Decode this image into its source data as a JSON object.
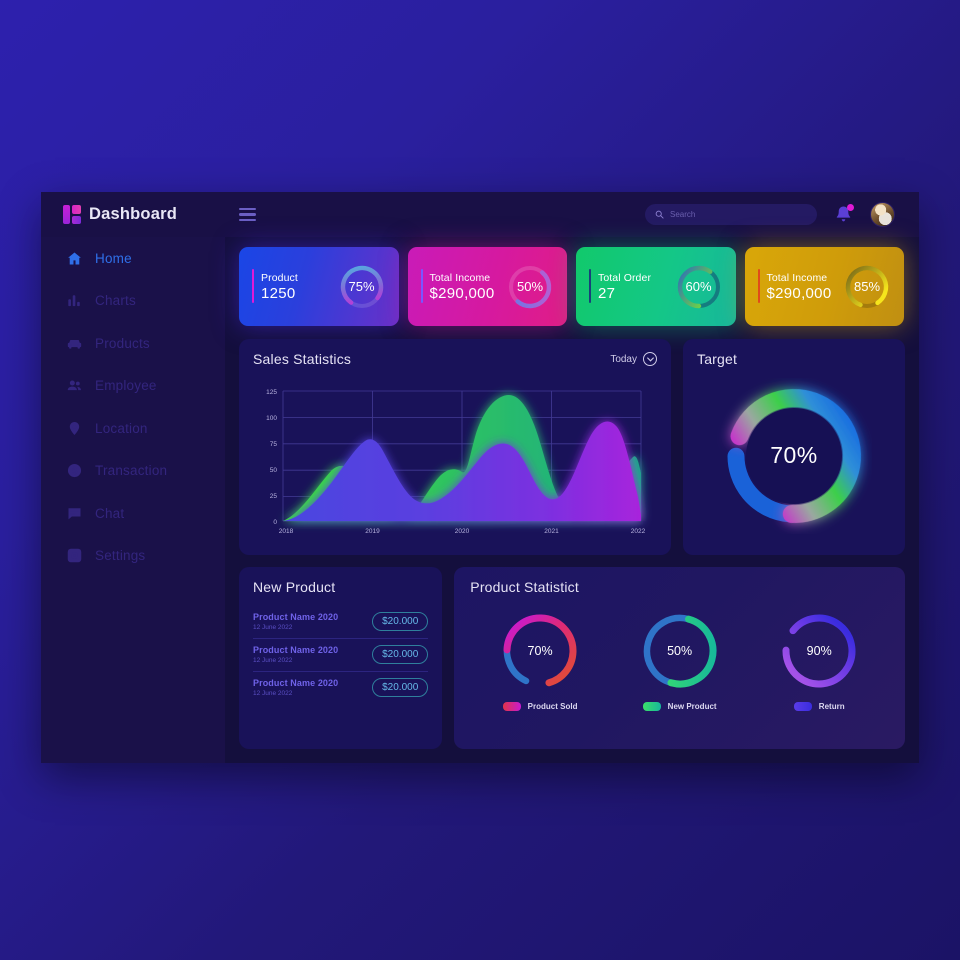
{
  "brand": {
    "title": "Dashboard",
    "logo_icon": "logo-blocks-icon"
  },
  "topbar": {
    "menu_icon": "hamburger-icon",
    "search": {
      "placeholder": "Search",
      "value": "",
      "icon": "search-icon"
    },
    "bell_icon": "bell-icon",
    "avatar": "user-avatar"
  },
  "sidebar": {
    "items": [
      {
        "label": "Home",
        "icon": "home-icon",
        "active": true
      },
      {
        "label": "Charts",
        "icon": "bar-chart-icon",
        "active": false
      },
      {
        "label": "Products",
        "icon": "car-icon",
        "active": false
      },
      {
        "label": "Employee",
        "icon": "people-icon",
        "active": false
      },
      {
        "label": "Location",
        "icon": "map-pin-icon",
        "active": false
      },
      {
        "label": "Transaction",
        "icon": "dollar-coin-icon",
        "active": false
      },
      {
        "label": "Chat",
        "icon": "chat-icon",
        "active": false
      },
      {
        "label": "Settings",
        "icon": "gear-icon",
        "active": false
      }
    ]
  },
  "stat_cards": [
    {
      "title": "Product",
      "value": "1250",
      "percent": "75%",
      "percent_num": 75,
      "accent": "#e01ad6",
      "ring_from": "#7b5fe8",
      "ring_to": "#e01ad6"
    },
    {
      "title": "Total Income",
      "value": "$290,000",
      "percent": "50%",
      "percent_num": 50,
      "accent": "#7a56ff",
      "ring_from": "#6f7ae8",
      "ring_to": "#b05bd8"
    },
    {
      "title": "Total Order",
      "value": "27",
      "percent": "60%",
      "percent_num": 60,
      "accent": "#18407a",
      "ring_from": "#2f6fb8",
      "ring_to": "#6ee038"
    },
    {
      "title": "Total Income",
      "value": "$290,000",
      "percent": "85%",
      "percent_num": 85,
      "accent": "#e04b1a",
      "ring_from": "#8a7a20",
      "ring_to": "#f2e31a"
    }
  ],
  "sales_panel": {
    "title": "Sales Statistics",
    "filter_label": "Today",
    "filter_icon": "chevron-down-circle-icon"
  },
  "target_panel": {
    "title": "Target",
    "percent": "70%",
    "percent_num": 70
  },
  "new_product_panel": {
    "title": "New Product",
    "rows": [
      {
        "name": "Product Name 2020",
        "date": "12 June 2022",
        "price": "$20.000"
      },
      {
        "name": "Product Name 2020",
        "date": "12 June 2022",
        "price": "$20.000"
      },
      {
        "name": "Product Name 2020",
        "date": "12 June 2022",
        "price": "$20.000"
      }
    ]
  },
  "product_statistic_panel": {
    "title": "Product Statistict",
    "donuts": [
      {
        "percent": "70%",
        "percent_num": 70,
        "label": "Product Sold",
        "from": "#e03a3a",
        "to": "#d61a9c"
      },
      {
        "percent": "50%",
        "percent_num": 50,
        "label": "New Product",
        "from": "#2fd07a",
        "to": "#18b79c"
      },
      {
        "percent": "90%",
        "percent_num": 90,
        "label": "Return",
        "from": "#9a4de8",
        "to": "#3a2ce0"
      }
    ]
  },
  "chart_data": [
    {
      "type": "area",
      "title": "Sales Statistics",
      "xlabel": "",
      "ylabel": "",
      "x": [
        "2018",
        "2019",
        "2020",
        "2021",
        "2022"
      ],
      "yticks": [
        0,
        25,
        50,
        75,
        100,
        125
      ],
      "ylim": [
        0,
        125
      ],
      "grid": true,
      "legend": "none",
      "series": [
        {
          "name": "Green series",
          "color": "#2fc45f",
          "values": [
            3,
            30,
            40,
            115,
            30,
            50
          ]
        },
        {
          "name": "Purple series",
          "color": "#6a3fe0",
          "values": [
            3,
            65,
            27,
            70,
            100,
            30
          ]
        }
      ],
      "note": "Two smooth stacked area curves; green peaks ~48 (mid-2018), ~60 (mid-2019), ~115 (mid-2020); purple peaks ~65 (2019), ~70 (mid-2020), ~100 (mid-2021)"
    },
    {
      "type": "pie",
      "title": "Target",
      "labels": [
        "Target"
      ],
      "values": [
        70
      ],
      "unit": "%",
      "center_label": "70%"
    },
    {
      "type": "pie",
      "title": "Product Statistict",
      "labels": [
        "Product Sold",
        "New Product",
        "Return"
      ],
      "values": [
        70,
        50,
        90
      ],
      "unit": "%"
    },
    {
      "type": "pie",
      "title": "Stat card rings",
      "labels": [
        "Product",
        "Total Income",
        "Total Order",
        "Total Income"
      ],
      "values": [
        75,
        50,
        60,
        85
      ],
      "unit": "%"
    }
  ]
}
